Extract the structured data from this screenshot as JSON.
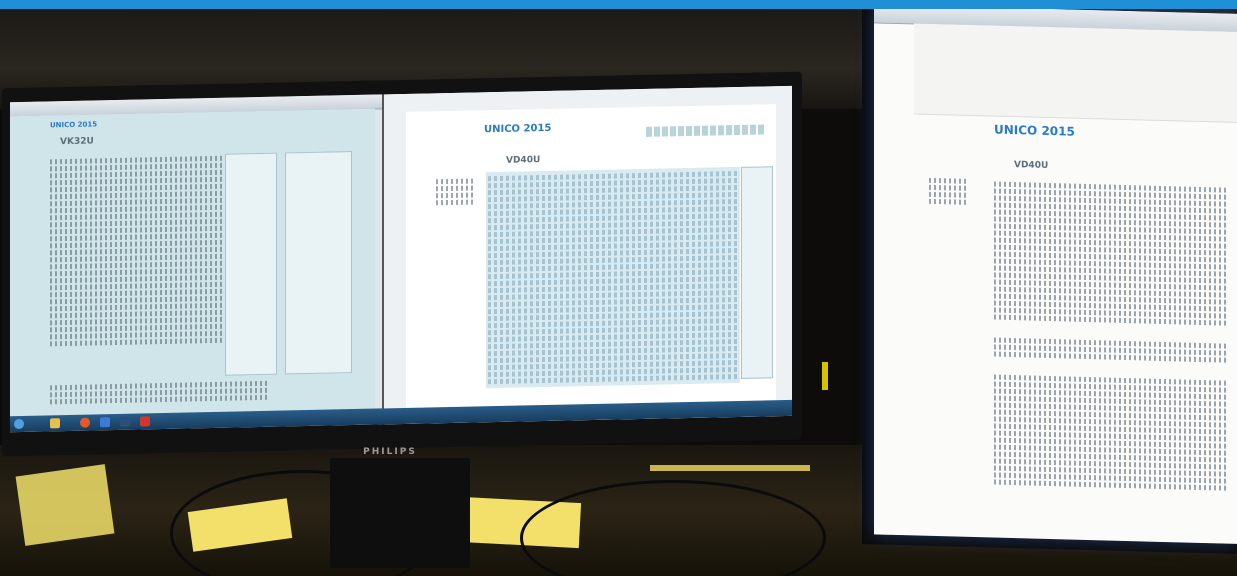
{
  "window": {
    "title_bar_color": "#1f8fd6"
  },
  "monitor_left": {
    "brand": "PHILIPS",
    "left_document": {
      "logo": "UNICO 2015",
      "model": "VK32U"
    },
    "middle_document": {
      "logo": "UNICO 2015",
      "model": "VD40U"
    }
  },
  "monitor_right": {
    "document": {
      "logo": "UNICO 2015",
      "model": "VD40U"
    }
  },
  "colors": {
    "form_blue": "#cfe5ea",
    "sticky_note": "#f2e06a",
    "logo_blue": "#2a7bc2"
  }
}
